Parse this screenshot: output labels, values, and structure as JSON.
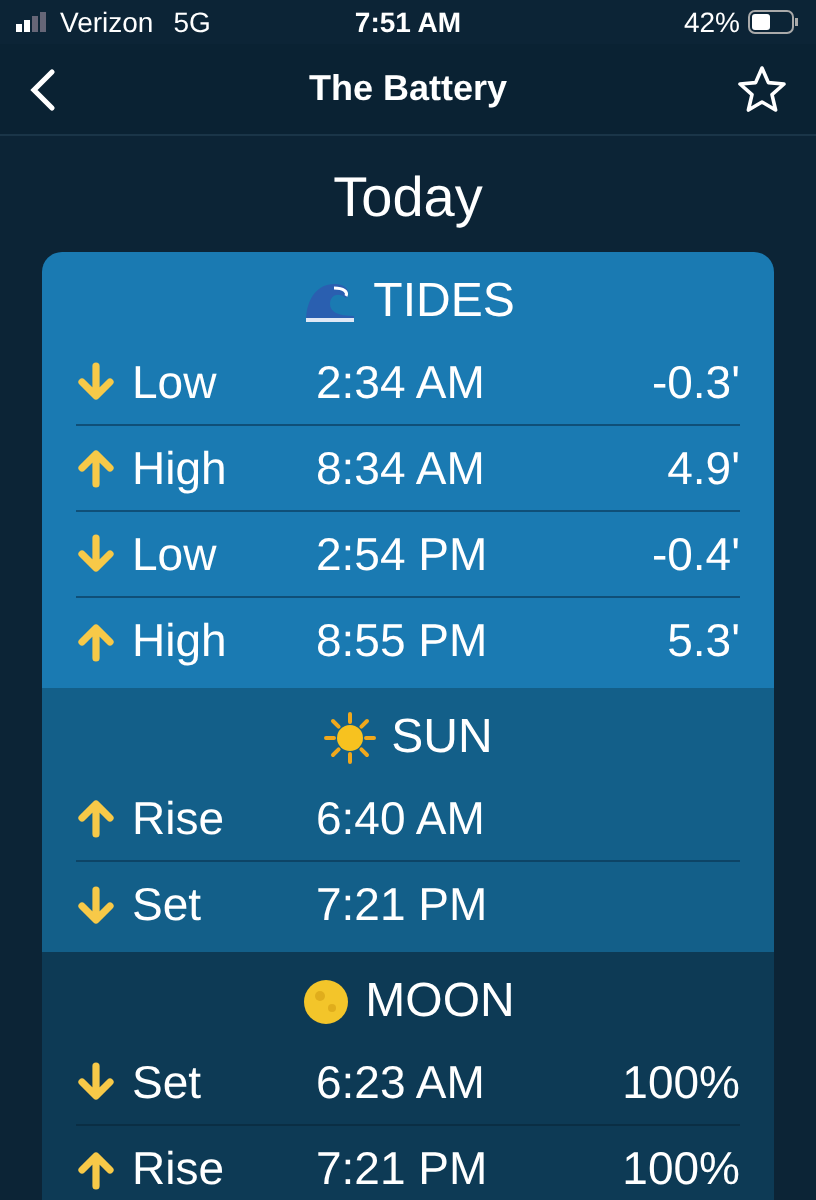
{
  "status_bar": {
    "carrier": "Verizon",
    "network": "5G",
    "time": "7:51 AM",
    "battery": "42%"
  },
  "nav": {
    "title": "The Battery",
    "favorite": false
  },
  "heading": "Today",
  "sections": [
    {
      "kind": "tides",
      "title": "TIDES",
      "rows": [
        {
          "kind": "down",
          "label": "Low",
          "time": "2:34 AM",
          "value": "-0.3'"
        },
        {
          "kind": "up",
          "label": "High",
          "time": "8:34 AM",
          "value": "4.9'"
        },
        {
          "kind": "down",
          "label": "Low",
          "time": "2:54 PM",
          "value": "-0.4'"
        },
        {
          "kind": "up",
          "label": "High",
          "time": "8:55 PM",
          "value": "5.3'"
        }
      ]
    },
    {
      "kind": "sun",
      "title": "SUN",
      "rows": [
        {
          "kind": "up",
          "label": "Rise",
          "time": "6:40 AM"
        },
        {
          "kind": "down",
          "label": "Set",
          "time": "7:21 PM"
        }
      ]
    },
    {
      "kind": "moon",
      "title": "MOON",
      "rows": [
        {
          "kind": "down",
          "label": "Set",
          "time": "6:23 AM",
          "value": "100%"
        },
        {
          "kind": "up",
          "label": "Rise",
          "time": "7:21 PM",
          "value": "100%"
        }
      ]
    }
  ]
}
